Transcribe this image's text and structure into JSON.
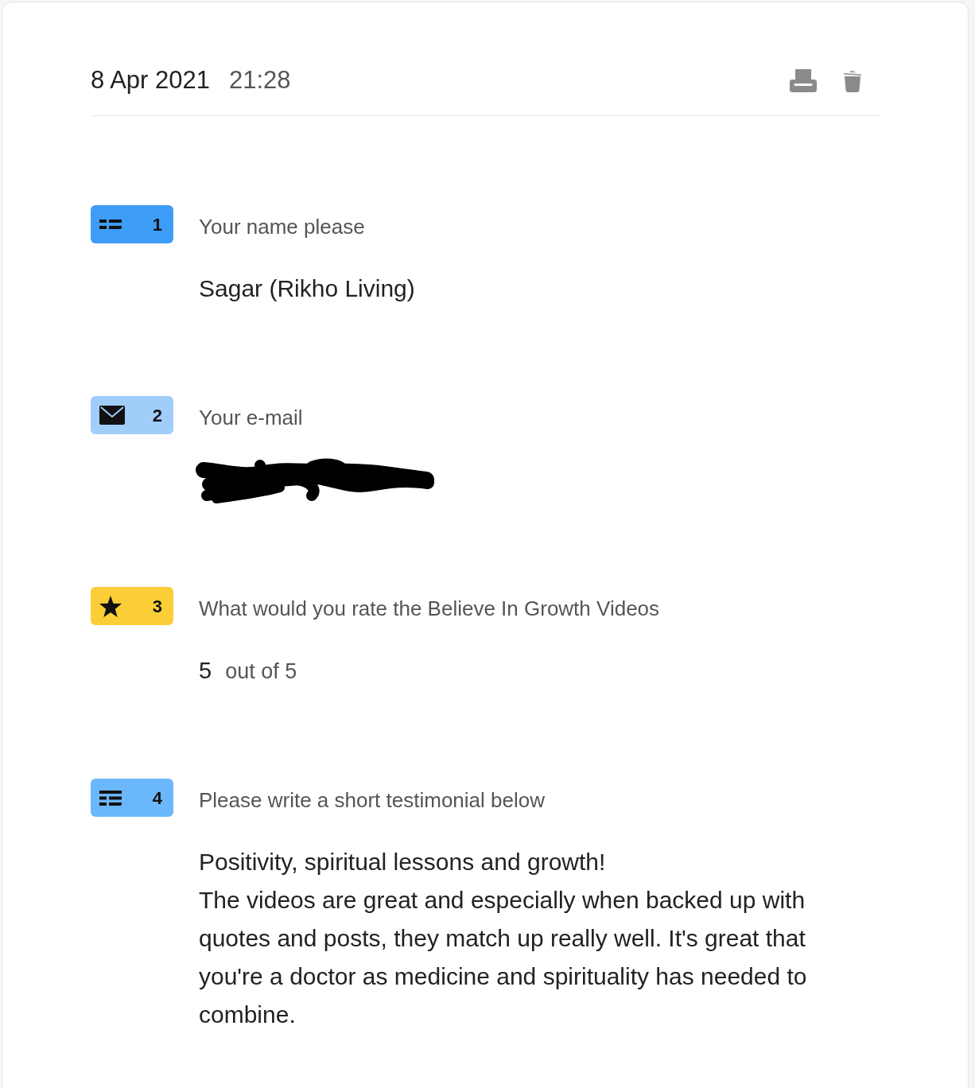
{
  "header": {
    "date": "8 Apr 2021",
    "time": "21:28"
  },
  "questions": [
    {
      "kind": "short_text",
      "number": "1",
      "color": "#3d9df6",
      "label": "Your name please",
      "answer": {
        "lines": [
          "Sagar (Rikho Living)"
        ]
      }
    },
    {
      "kind": "email",
      "number": "2",
      "color": "#a1cdfa",
      "label": "Your e-mail",
      "answer": {
        "redacted": true
      }
    },
    {
      "kind": "rating",
      "number": "3",
      "color": "#fbcd36",
      "label": "What would you rate the Believe In Growth Videos",
      "answer": {
        "value": "5",
        "scale": "out of 5"
      }
    },
    {
      "kind": "long_text",
      "number": "4",
      "color": "#6bb7fb",
      "label": "Please write a short testimonial below",
      "answer": {
        "lines": [
          "Positivity, spiritual lessons and growth!",
          "The videos are great and especially when backed up with quotes and posts, they match up really well. It's great that you're a doctor as medicine and spirituality has needed to combine."
        ]
      }
    }
  ]
}
